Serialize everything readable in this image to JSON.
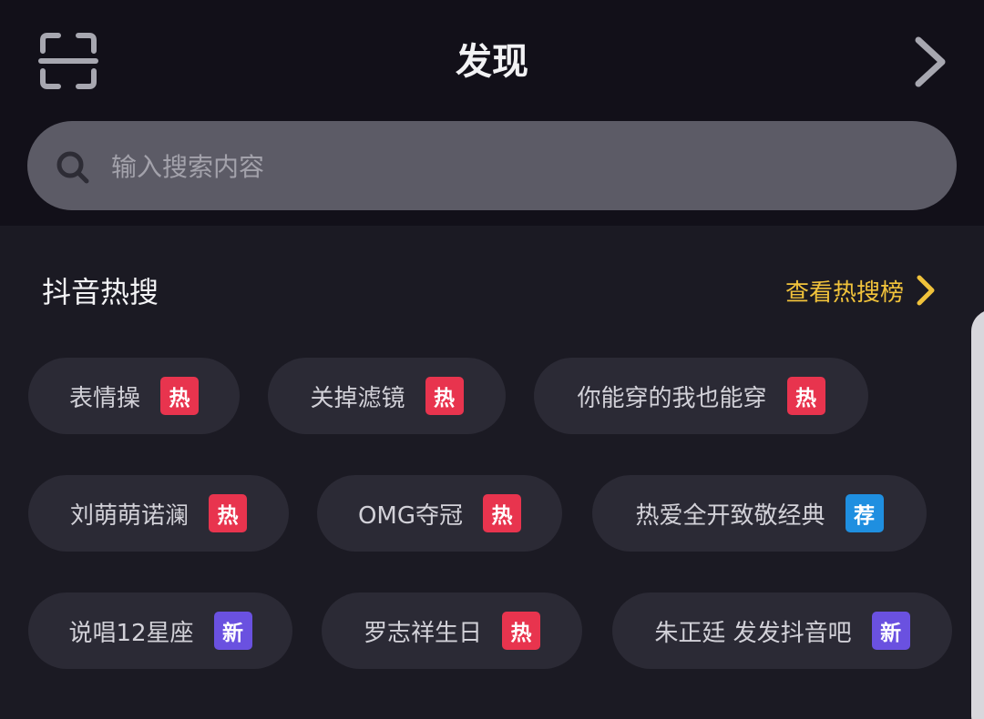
{
  "header": {
    "title": "发现",
    "scan_icon": "scan-icon",
    "next_icon": "chevron-right-icon"
  },
  "search": {
    "icon": "search-icon",
    "placeholder": "输入搜索内容"
  },
  "hot_section": {
    "title": "抖音热搜",
    "view_board_label": "查看热搜榜",
    "view_board_icon": "chevron-right-icon",
    "items": [
      {
        "label": "表情操",
        "badge": "热",
        "badge_color": "#e8344e"
      },
      {
        "label": "关掉滤镜",
        "badge": "热",
        "badge_color": "#e8344e"
      },
      {
        "label": "你能穿的我也能穿",
        "badge": "热",
        "badge_color": "#e8344e"
      },
      {
        "label": "刘萌萌诺澜",
        "badge": "热",
        "badge_color": "#e8344e"
      },
      {
        "label": "OMG夺冠",
        "badge": "热",
        "badge_color": "#e8344e"
      },
      {
        "label": "热爱全开致敬经典",
        "badge": "荐",
        "badge_color": "#1f8fe0"
      },
      {
        "label": "说唱12星座",
        "badge": "新",
        "badge_color": "#6a51e0"
      },
      {
        "label": "罗志祥生日",
        "badge": "热",
        "badge_color": "#e8344e"
      },
      {
        "label": "朱正廷 发发抖音吧",
        "badge": "新",
        "badge_color": "#6a51e0"
      }
    ]
  },
  "colors": {
    "background": "#1b1a23",
    "header_background": "#121019",
    "search_background": "#5c5b66",
    "pill_background": "#2b2a35",
    "accent_gold": "#f0c23b",
    "hot_badge": "#e8344e",
    "recommend_badge": "#1f8fe0",
    "new_badge": "#6a51e0"
  }
}
